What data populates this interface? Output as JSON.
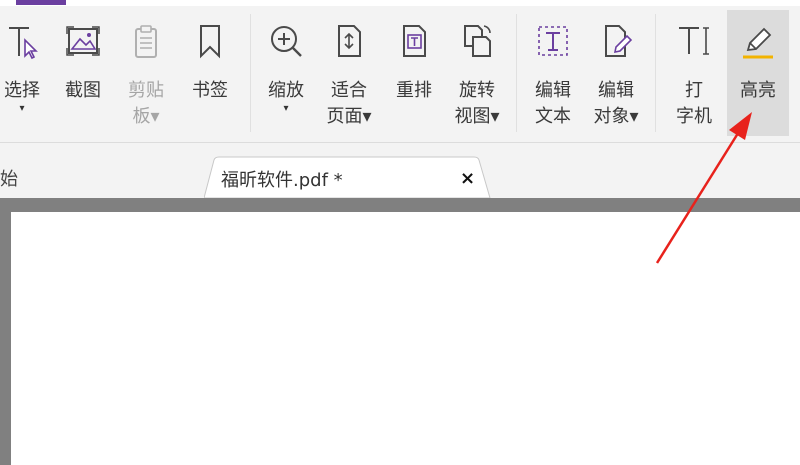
{
  "ribbon": {
    "tools": [
      {
        "id": "select",
        "line1": "选择",
        "line2": "▾",
        "icon": "text-cursor-select-icon",
        "enabled": true
      },
      {
        "id": "snapshot",
        "line1": "截图",
        "line2": "",
        "icon": "screenshot-image-icon",
        "enabled": true
      },
      {
        "id": "clipboard",
        "line1": "剪贴",
        "line2": "板▾",
        "icon": "clipboard-icon",
        "enabled": false
      },
      {
        "id": "bookmark",
        "line1": "书签",
        "line2": "",
        "icon": "bookmark-icon",
        "enabled": true
      },
      {
        "id": "zoom",
        "line1": "缩放",
        "line2": "▾",
        "icon": "zoom-in-icon",
        "enabled": true
      },
      {
        "id": "fit-page",
        "line1": "适合",
        "line2": "页面▾",
        "icon": "fit-page-icon",
        "enabled": true
      },
      {
        "id": "reflow",
        "line1": "重排",
        "line2": "",
        "icon": "reflow-icon",
        "enabled": true
      },
      {
        "id": "rotate-view",
        "line1": "旋转",
        "line2": "视图▾",
        "icon": "rotate-view-icon",
        "enabled": true
      },
      {
        "id": "edit-text",
        "line1": "编辑",
        "line2": "文本",
        "icon": "edit-text-icon",
        "enabled": true
      },
      {
        "id": "edit-object",
        "line1": "编辑",
        "line2": "对象▾",
        "icon": "edit-object-icon",
        "enabled": true
      },
      {
        "id": "typewriter",
        "line1": "打",
        "line2": "字机",
        "icon": "typewriter-icon",
        "enabled": true
      },
      {
        "id": "highlight",
        "line1": "高亮",
        "line2": "",
        "icon": "highlight-pen-icon",
        "enabled": true,
        "active": true
      }
    ]
  },
  "tabs": {
    "start": "开始",
    "file": "福昕软件.pdf *",
    "close": "×"
  },
  "colors": {
    "accent": "#6b3fa0",
    "arrow": "#e8221c",
    "highlight_underline": "#f2b300"
  }
}
